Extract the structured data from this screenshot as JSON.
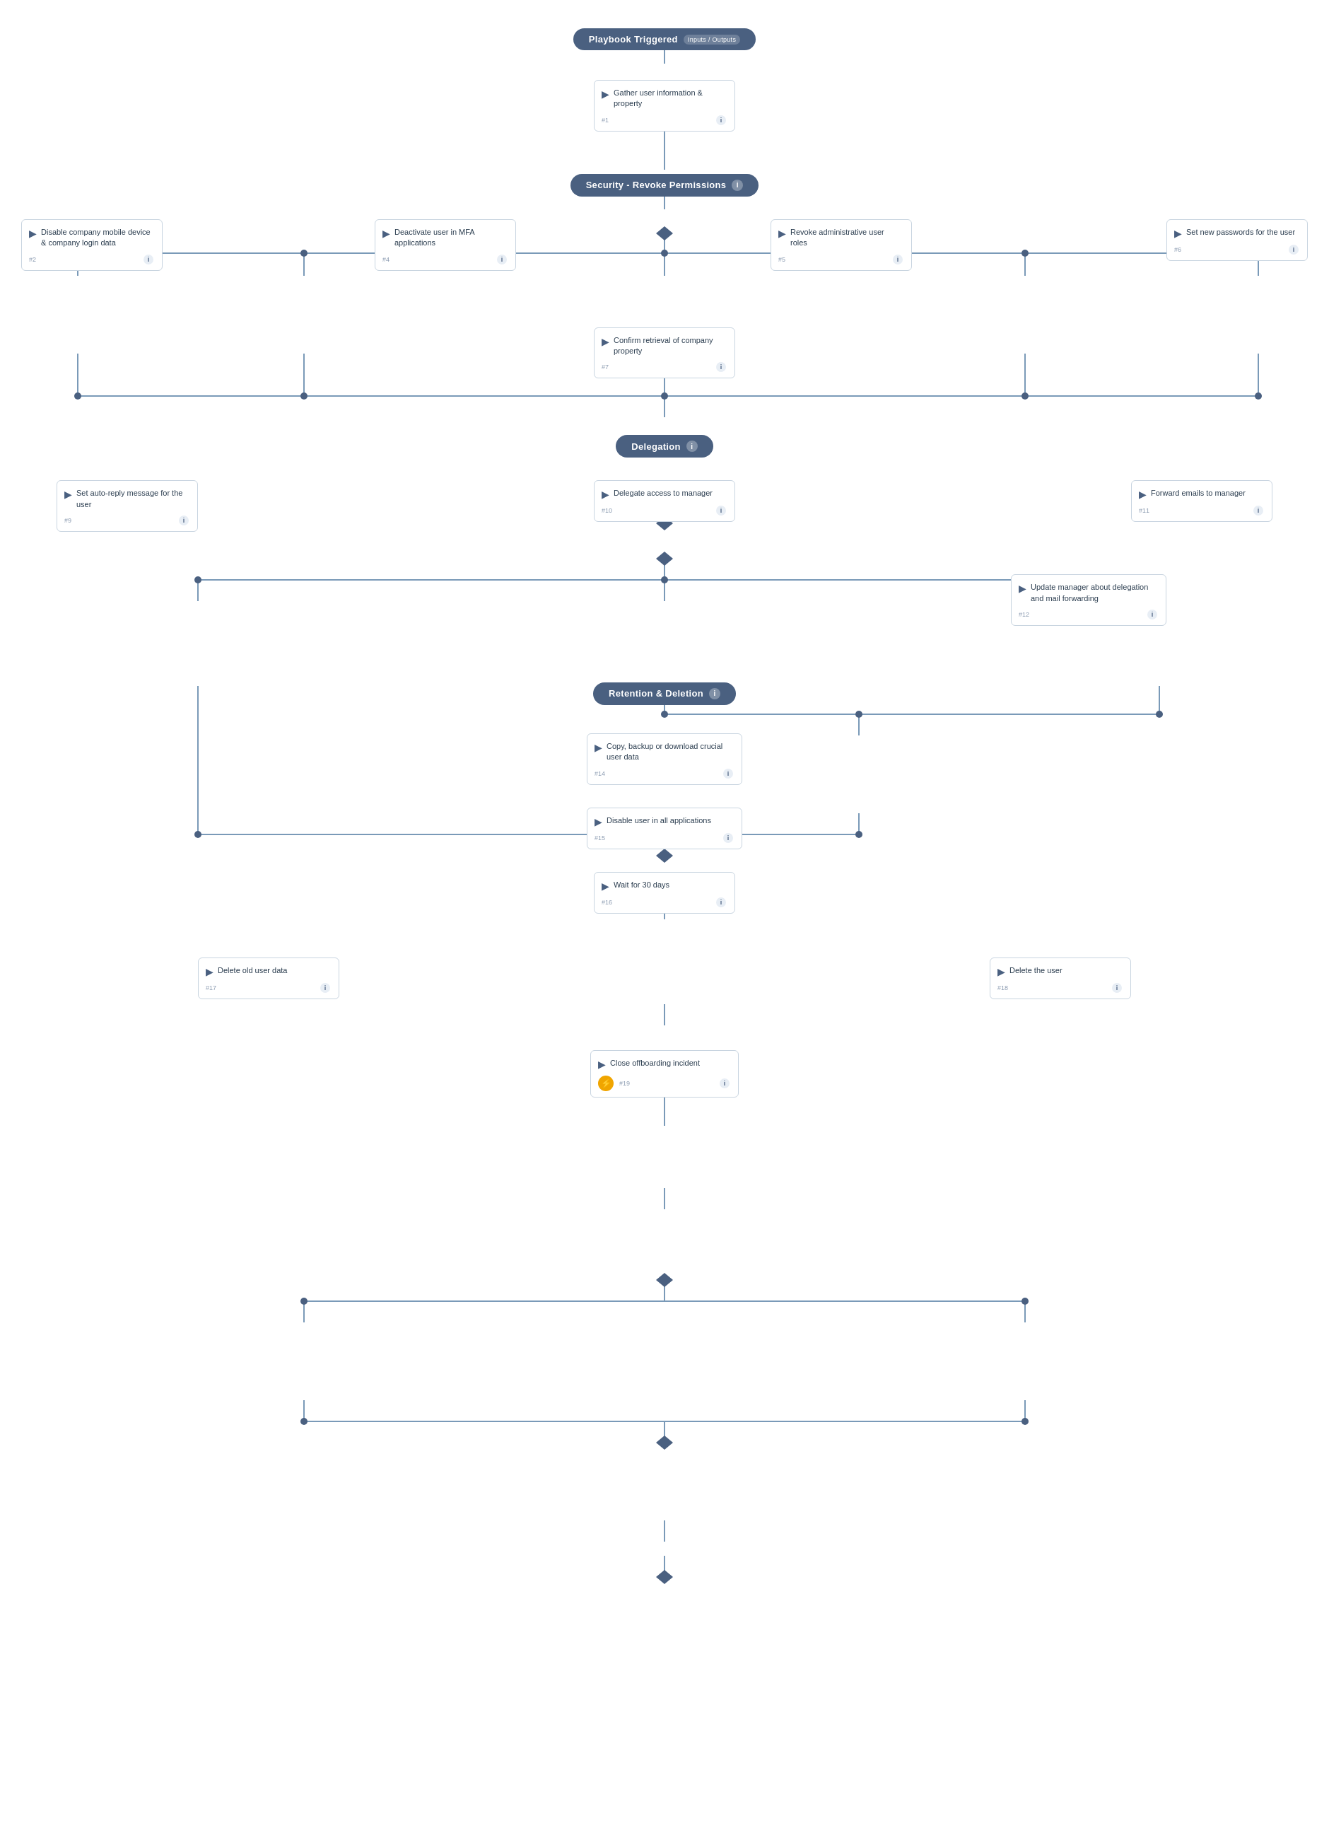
{
  "trigger": {
    "label": "Playbook Triggered",
    "tag": "Inputs / Outputs"
  },
  "phases": [
    {
      "id": "security",
      "label": "Security - Revoke Permissions",
      "showInfo": true
    },
    {
      "id": "delegation",
      "label": "Delegation",
      "showInfo": true
    },
    {
      "id": "retention",
      "label": "Retention & Deletion",
      "showInfo": true
    }
  ],
  "tasks": {
    "t1": {
      "title": "Gather user information & property",
      "num": "#1"
    },
    "t2": {
      "title": "Disable company mobile device & company login data",
      "num": "#2"
    },
    "t3": {
      "title": "Deactivate user in MFA applications",
      "num": "#4"
    },
    "t4": {
      "title": "Revoke administrative user roles",
      "num": "#5"
    },
    "t5": {
      "title": "Set new passwords for the user",
      "num": "#6"
    },
    "t6": {
      "title": "Confirm retrieval of company property",
      "num": "#7"
    },
    "t7": {
      "title": "Set auto-reply message for the user",
      "num": "#9"
    },
    "t8": {
      "title": "Delegate access to manager",
      "num": "#10"
    },
    "t9": {
      "title": "Forward emails to manager",
      "num": "#11"
    },
    "t10": {
      "title": "Update manager about delegation and mail forwarding",
      "num": "#12"
    },
    "t11": {
      "title": "Copy, backup or download crucial user data",
      "num": "#14"
    },
    "t12": {
      "title": "Disable user in all applications",
      "num": "#15"
    },
    "t13": {
      "title": "Wait for 30 days",
      "num": "#16"
    },
    "t14": {
      "title": "Delete old user data",
      "num": "#17"
    },
    "t15": {
      "title": "Delete the user",
      "num": "#18"
    },
    "t16": {
      "title": "Close offboarding incident",
      "num": "#19"
    }
  },
  "icons": {
    "info": "i",
    "arrow": "▶",
    "lightning": "⚡"
  }
}
